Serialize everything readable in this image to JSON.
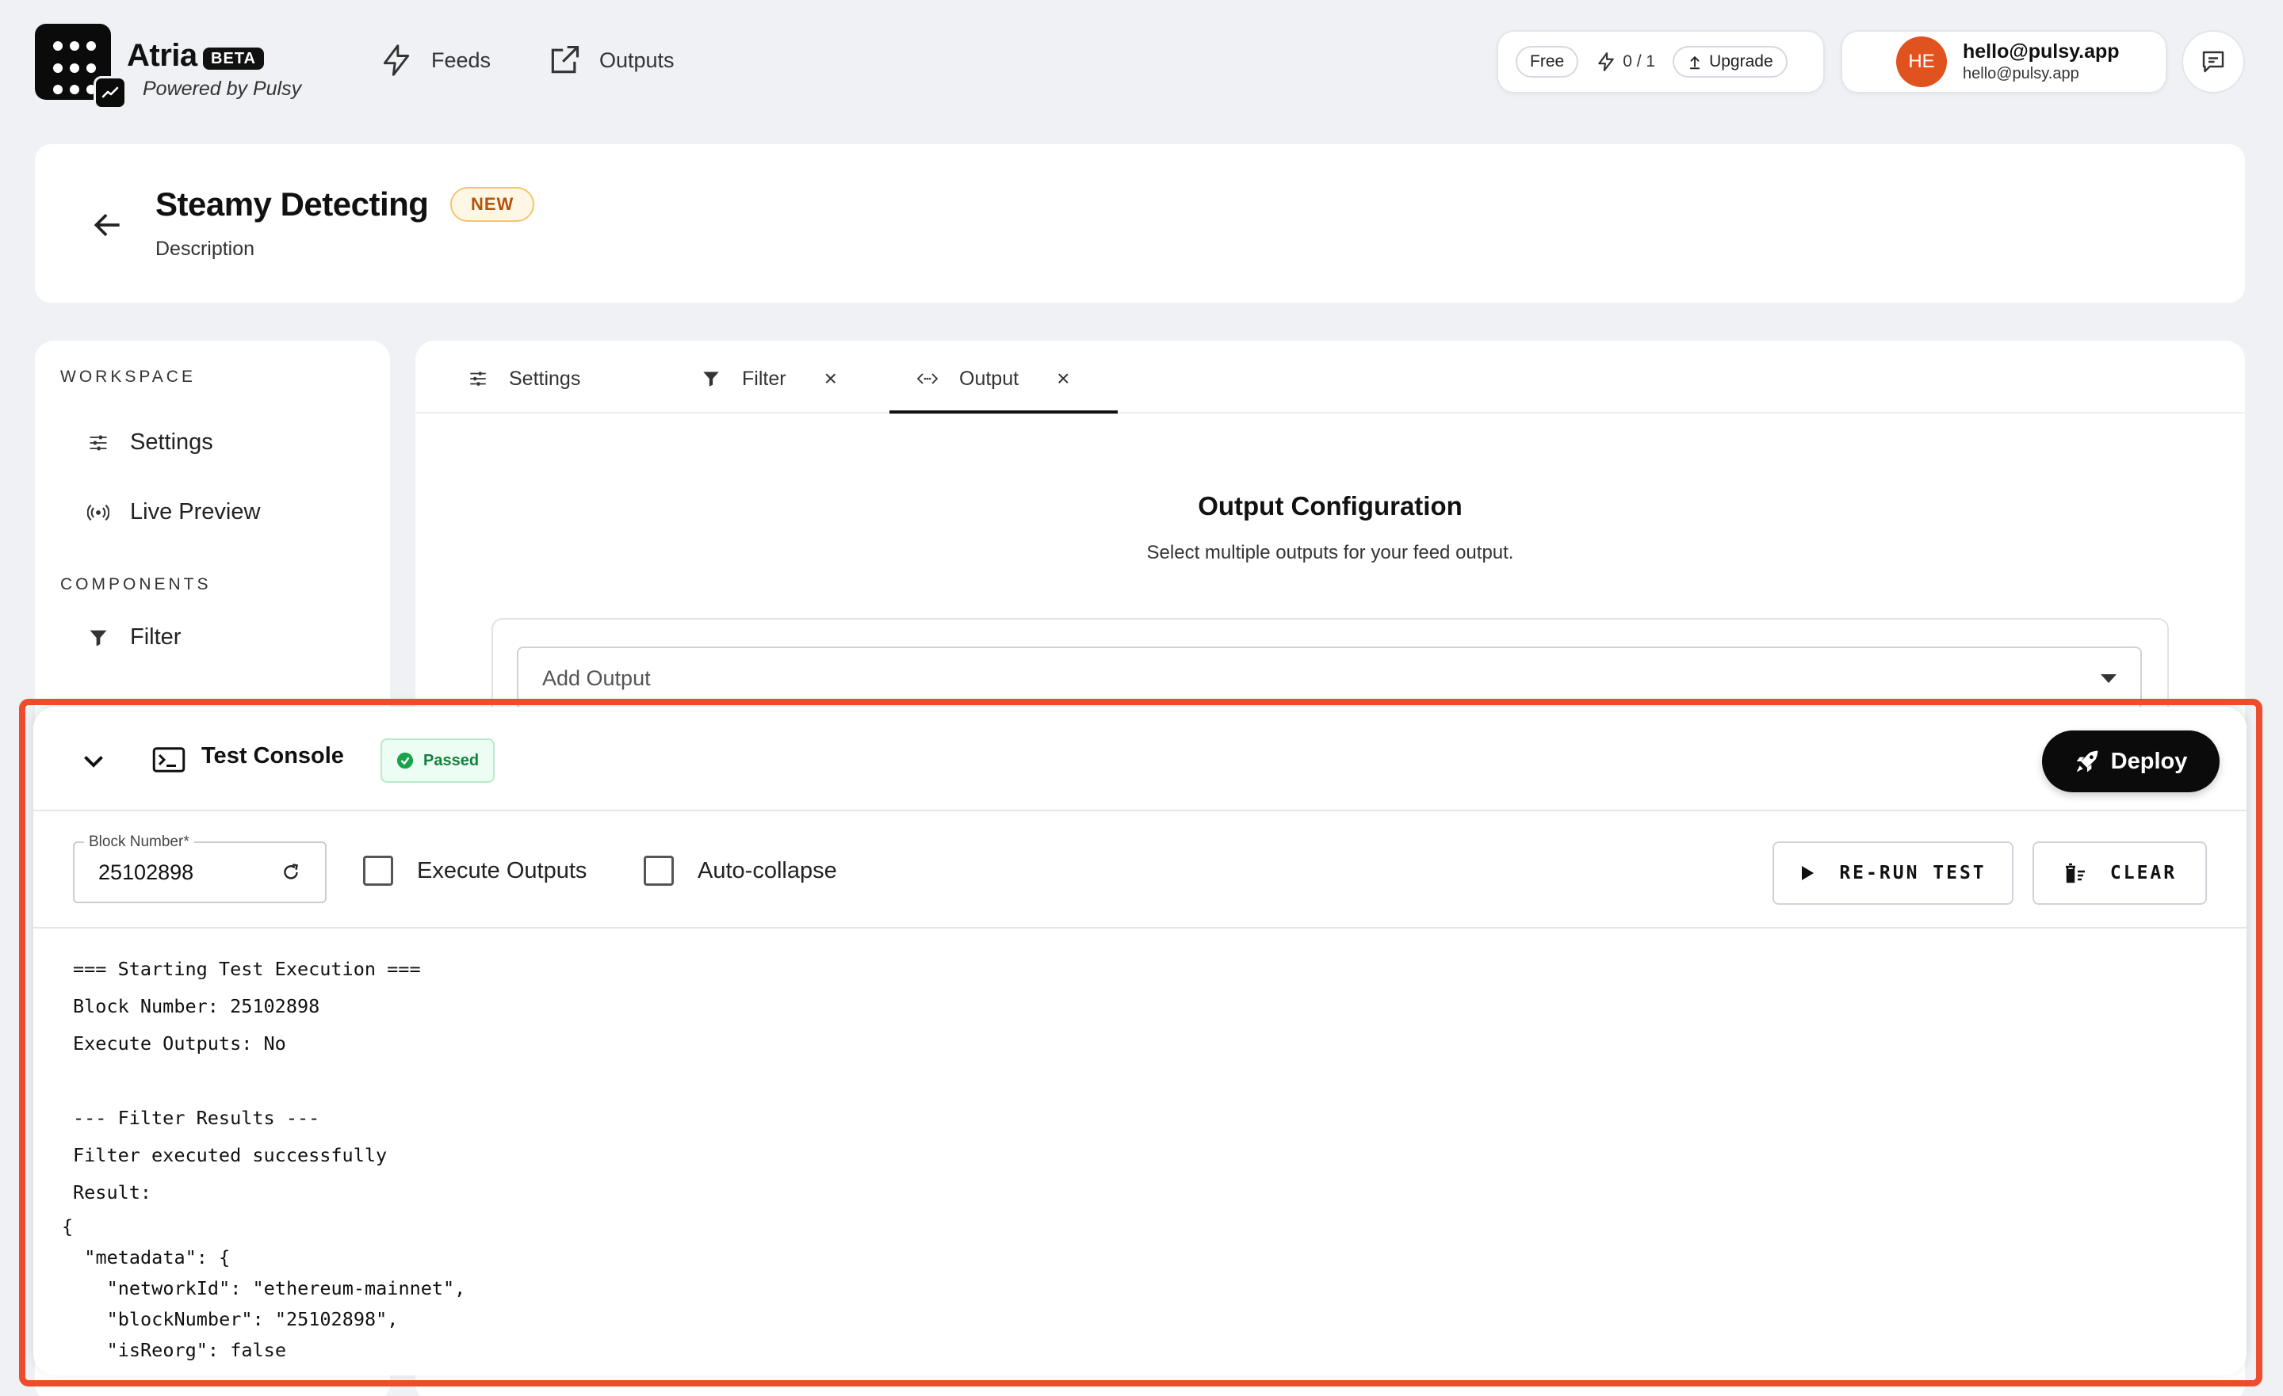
{
  "brand": {
    "name": "Atria",
    "beta_label": "BETA",
    "powered_by": "Powered by Pulsy"
  },
  "nav": {
    "feeds_label": "Feeds",
    "outputs_label": "Outputs"
  },
  "plan": {
    "tier": "Free",
    "credits": "0 / 1",
    "upgrade_label": "Upgrade"
  },
  "user": {
    "initials": "HE",
    "email": "hello@pulsy.app",
    "sub_email": "hello@pulsy.app"
  },
  "header": {
    "title": "Steamy Detecting",
    "badge": "NEW",
    "description": "Description"
  },
  "sidebar": {
    "workspace_heading": "WORKSPACE",
    "workspace_items": [
      {
        "label": "Settings"
      },
      {
        "label": "Live Preview"
      }
    ],
    "components_heading": "COMPONENTS",
    "component_items": [
      {
        "label": "Filter"
      }
    ]
  },
  "tabs": [
    {
      "label": "Settings"
    },
    {
      "label": "Filter"
    },
    {
      "label": "Output"
    }
  ],
  "output_config": {
    "title": "Output Configuration",
    "subtitle": "Select multiple outputs for your feed output.",
    "select_placeholder": "Add Output"
  },
  "console": {
    "title": "Test Console",
    "status": "Passed",
    "deploy_label": "Deploy",
    "block_number_label": "Block Number*",
    "block_number_value": "25102898",
    "execute_outputs_label": "Execute Outputs",
    "auto_collapse_label": "Auto-collapse",
    "rerun_label": "RE-RUN TEST",
    "clear_label": "CLEAR",
    "log_lines": [
      "=== Starting Test Execution ===",
      "Block Number: 25102898",
      "Execute Outputs: No",
      "",
      "--- Filter Results ---",
      "Filter executed successfully",
      "Result:"
    ],
    "json_lines": [
      "{",
      "  \"metadata\": {",
      "    \"networkId\": \"ethereum-mainnet\",",
      "    \"blockNumber\": \"25102898\",",
      "    \"isReorg\": false"
    ]
  },
  "colors": {
    "highlight_border": "#ee4d2d",
    "avatar": "#e0531f",
    "passed_green": "#15803d",
    "new_badge": "#b45309"
  }
}
